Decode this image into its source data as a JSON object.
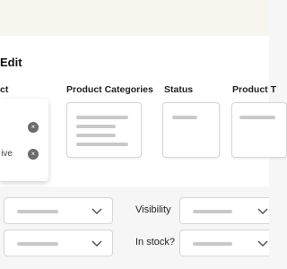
{
  "header": {
    "title": "Edit"
  },
  "columns": {
    "first_partial": "ct",
    "product_categories": "Product Categories",
    "status": "Status",
    "product_partial": "Product T"
  },
  "popover": {
    "option_text_partial": "ive",
    "clear_icon_glyph": "×"
  },
  "filters": {
    "visibility_label": "Visibility",
    "in_stock_label": "In stock?"
  }
}
